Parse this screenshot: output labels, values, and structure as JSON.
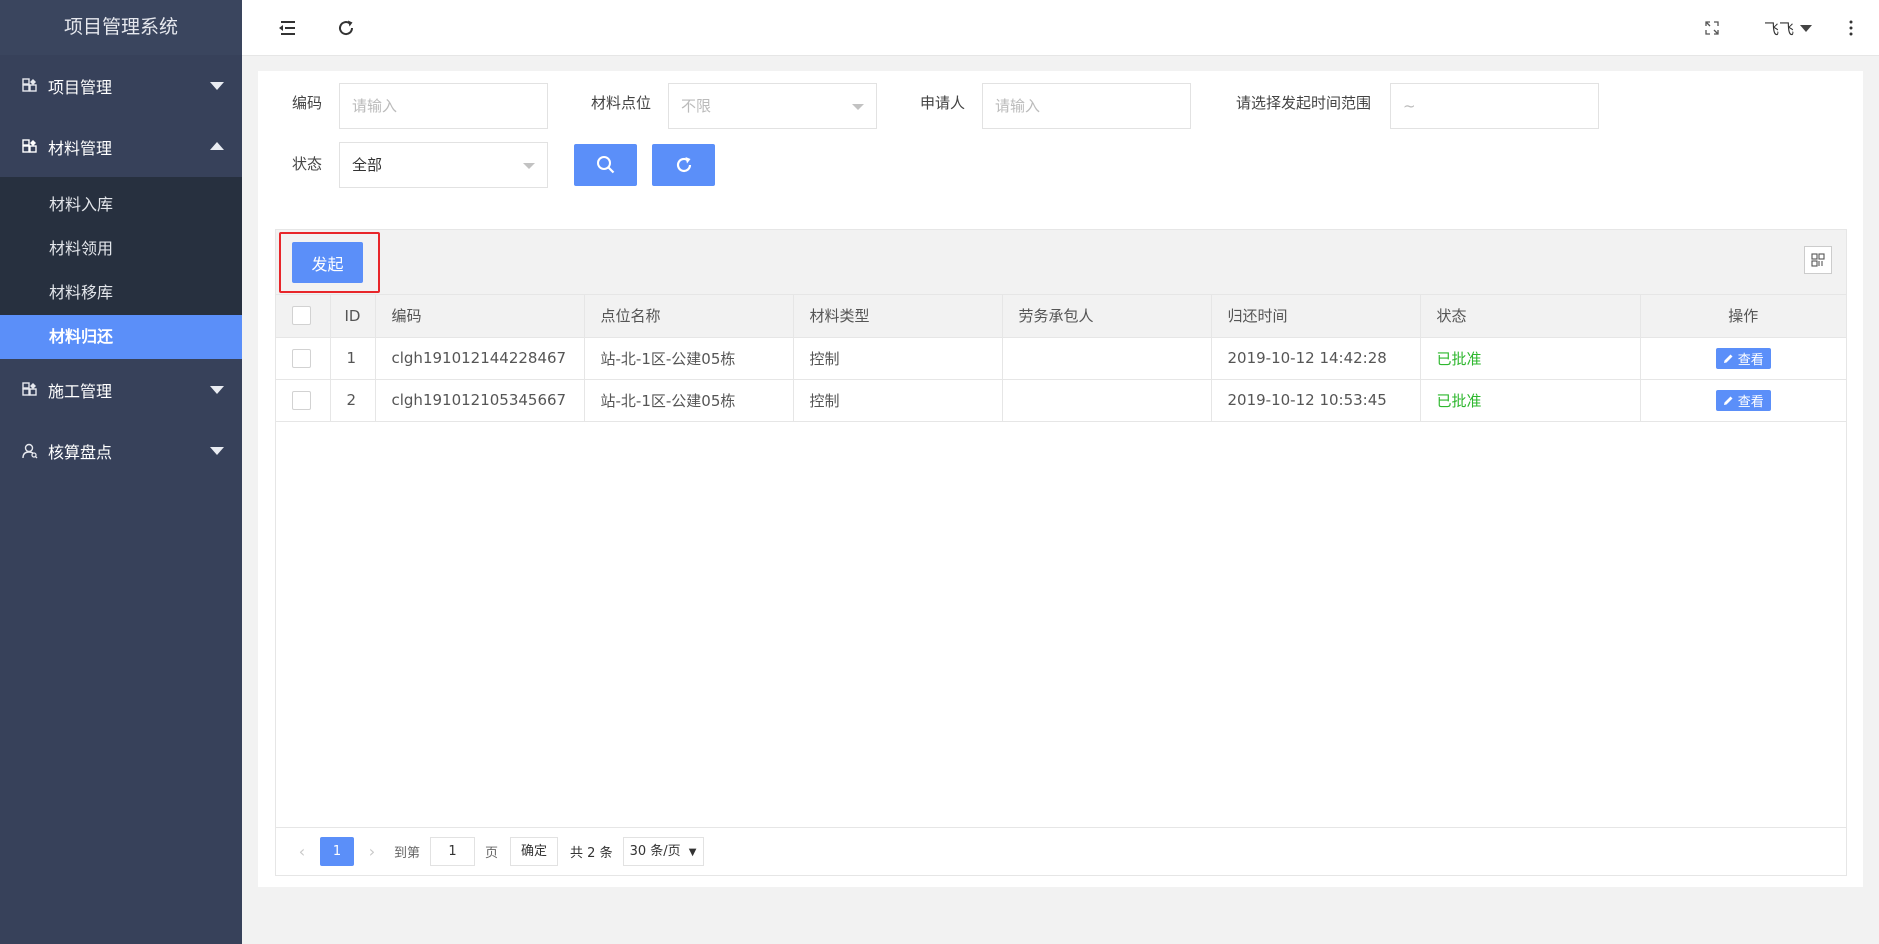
{
  "app": {
    "title": "项目管理系统"
  },
  "sidebar": {
    "groups": [
      {
        "label": "项目管理",
        "expanded": false
      },
      {
        "label": "材料管理",
        "expanded": true,
        "items": [
          "材料入库",
          "材料领用",
          "材料移库",
          "材料归还"
        ],
        "active": "材料归还"
      },
      {
        "label": "施工管理",
        "expanded": false
      },
      {
        "label": "核算盘点",
        "expanded": false
      }
    ]
  },
  "header": {
    "user_name": "飞飞",
    "icons": [
      "menu-fold-icon",
      "refresh-icon",
      "fullscreen-icon",
      "more-vertical-icon"
    ]
  },
  "filters": {
    "code_label": "编码",
    "code_placeholder": "请输入",
    "location_label": "材料点位",
    "location_value": "不限",
    "applicant_label": "申请人",
    "applicant_placeholder": "请输入",
    "time_label": "请选择发起时间范围",
    "time_value": "~",
    "status_label": "状态",
    "status_value": "全部"
  },
  "toolbar": {
    "launch_label": "发起"
  },
  "table": {
    "headers": [
      "ID",
      "编码",
      "点位名称",
      "材料类型",
      "劳务承包人",
      "归还时间",
      "状态",
      "操作"
    ],
    "rows": [
      {
        "id": "1",
        "code": "clgh191012144228467",
        "location": "站-北-1区-公建05栋",
        "type": "控制",
        "contractor": "",
        "time": "2019-10-12 14:42:28",
        "status": "已批准",
        "action": "查看"
      },
      {
        "id": "2",
        "code": "clgh191012105345667",
        "location": "站-北-1区-公建05栋",
        "type": "控制",
        "contractor": "",
        "time": "2019-10-12 10:53:45",
        "status": "已批准",
        "action": "查看"
      }
    ]
  },
  "pager": {
    "current": "1",
    "goto_prefix": "到第",
    "goto_value": "1",
    "goto_suffix": "页",
    "confirm": "确定",
    "total": "共 2 条",
    "page_size": "30 条/页"
  },
  "colors": {
    "primary": "#5b8ff9",
    "sidebar": "#37415a",
    "sidebar_sub": "#27303f",
    "approved": "#2eb72e",
    "highlight": "#e8262a"
  }
}
